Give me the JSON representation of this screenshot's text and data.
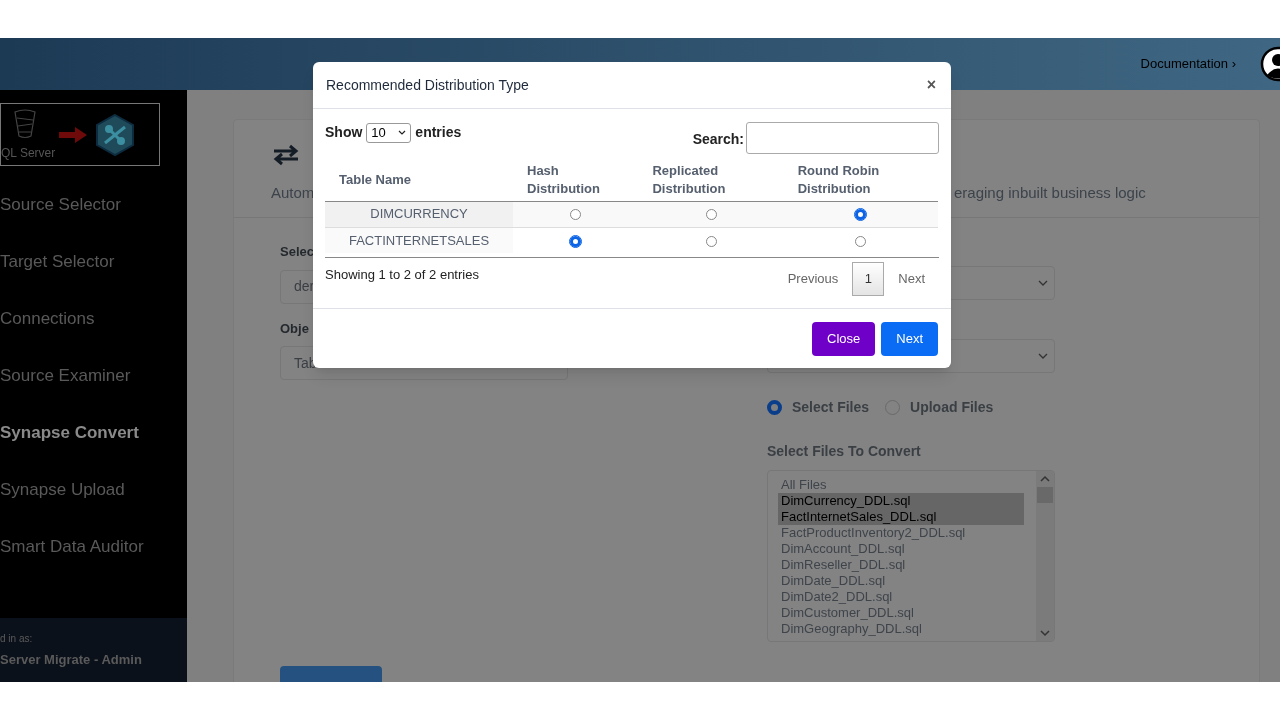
{
  "header": {
    "documentation_link": "Documentation ›"
  },
  "sidebar": {
    "logo": {
      "source_label": "QL Server"
    },
    "items": [
      {
        "label": "Source Selector",
        "selected": false
      },
      {
        "label": "Target Selector",
        "selected": false
      },
      {
        "label": "Connections",
        "selected": false
      },
      {
        "label": "Source Examiner",
        "selected": false
      },
      {
        "label": "Synapse Convert",
        "selected": true
      },
      {
        "label": "Synapse Upload",
        "selected": false
      },
      {
        "label": "Smart Data Auditor",
        "selected": false
      }
    ],
    "footer": {
      "caption": "d in as:",
      "user": "Server Migrate - Admin"
    }
  },
  "card": {
    "description_start": "Autom",
    "description_end": "eraging inbuilt business logic",
    "left_form": {
      "label_1": "Selec",
      "value_1": "der",
      "label_2": "Obje",
      "value_2": "Tab"
    },
    "file_source": [
      {
        "label": "Select Files",
        "selected": true
      },
      {
        "label": "Upload Files",
        "selected": false
      }
    ],
    "files_label": "Select Files To Convert",
    "files": [
      {
        "name": "All Files",
        "selected": false
      },
      {
        "name": "DimCurrency_DDL.sql",
        "selected": true
      },
      {
        "name": "FactInternetSales_DDL.sql",
        "selected": true
      },
      {
        "name": "FactProductInventory2_DDL.sql",
        "selected": false
      },
      {
        "name": "DimAccount_DDL.sql",
        "selected": false
      },
      {
        "name": "DimReseller_DDL.sql",
        "selected": false
      },
      {
        "name": "DimDate_DDL.sql",
        "selected": false
      },
      {
        "name": "DimDate2_DDL.sql",
        "selected": false
      },
      {
        "name": "DimCustomer_DDL.sql",
        "selected": false
      },
      {
        "name": "DimGeography_DDL.sql",
        "selected": false
      }
    ]
  },
  "modal": {
    "title": "Recommended Distribution Type",
    "close": "×",
    "show_label": "Show",
    "page_length": "10",
    "entries_label": "entries",
    "search_label": "Search:",
    "columns": [
      {
        "label": "Table Name"
      },
      {
        "label": "Hash Distribution"
      },
      {
        "label": "Replicated Distribution"
      },
      {
        "label": "Round Robin Distribution"
      }
    ],
    "rows": [
      {
        "table_name": "DIMCURRENCY",
        "options": [
          {
            "selected": false
          },
          {
            "selected": false
          },
          {
            "selected": true
          }
        ]
      },
      {
        "table_name": "FACTINTERNETSALES",
        "options": [
          {
            "selected": true
          },
          {
            "selected": false
          },
          {
            "selected": false
          }
        ]
      }
    ],
    "info": "Showing 1 to 2 of 2 entries",
    "previous": "Previous",
    "pages": [
      {
        "label": "1",
        "selected": true
      }
    ],
    "next": "Next",
    "buttons": [
      {
        "label": "Close",
        "kind": "secondary"
      },
      {
        "label": "Next",
        "kind": "primary"
      }
    ]
  }
}
